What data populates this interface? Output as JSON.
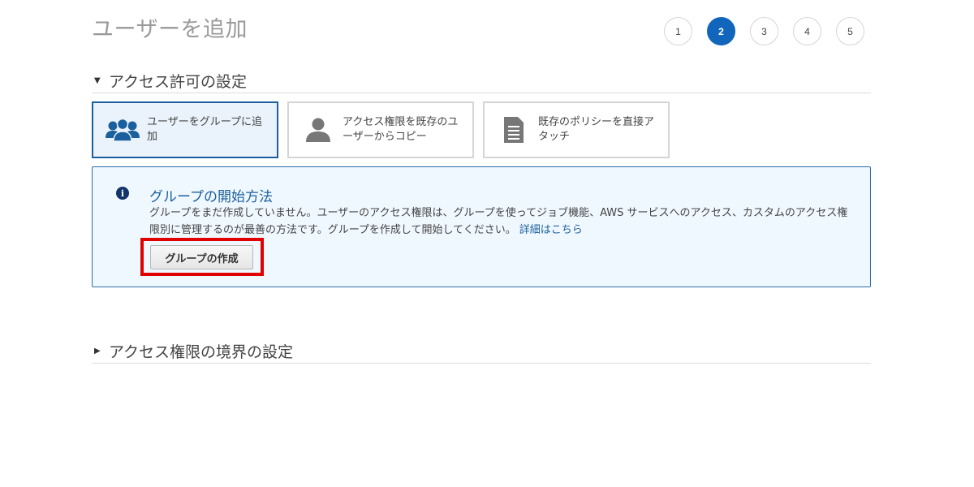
{
  "page": {
    "title": "ユーザーを追加"
  },
  "steps": [
    {
      "label": "1",
      "active": false
    },
    {
      "label": "2",
      "active": true
    },
    {
      "label": "3",
      "active": false
    },
    {
      "label": "4",
      "active": false
    },
    {
      "label": "5",
      "active": false
    }
  ],
  "permissions_section": {
    "title": "アクセス許可の設定",
    "caret_icon": "caret-down-icon",
    "options": [
      {
        "label": "ユーザーをグループに追加",
        "icon": "users-group-icon",
        "selected": true
      },
      {
        "label": "アクセス権限を既存のユーザーからコピー",
        "icon": "user-icon",
        "selected": false
      },
      {
        "label": "既存のポリシーを直接アタッチ",
        "icon": "document-icon",
        "selected": false
      }
    ]
  },
  "info_box": {
    "icon": "info-icon",
    "title": "グループの開始方法",
    "text": "グループをまだ作成していません。ユーザーのアクセス権限は、グループを使ってジョブ機能、AWS サービスへのアクセス、カスタムのアクセス権限別に管理するのが最善の方法です。グループを作成して開始してください。",
    "link_label": "詳細はこちら",
    "button_label": "グループの作成",
    "highlight_color": "#e00000"
  },
  "boundary_section": {
    "title": "アクセス権限の境界の設定",
    "caret_icon": "caret-right-icon"
  },
  "colors": {
    "accent": "#1166bb",
    "link": "#1b5f9e",
    "info_background": "#f0f8ff"
  }
}
